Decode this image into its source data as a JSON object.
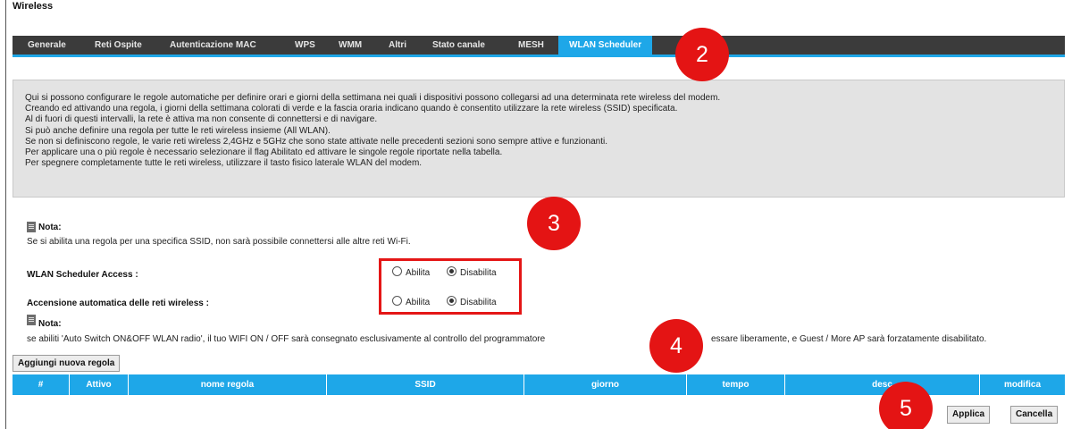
{
  "page": {
    "title": "Wireless"
  },
  "tabs": [
    {
      "label": "Generale",
      "active": false
    },
    {
      "label": "Reti Ospite",
      "active": false
    },
    {
      "label": "Autenticazione MAC",
      "active": false
    },
    {
      "label": "WPS",
      "active": false
    },
    {
      "label": "WMM",
      "active": false
    },
    {
      "label": "Altri",
      "active": false
    },
    {
      "label": "Stato canale",
      "active": false
    },
    {
      "label": "MESH",
      "active": false
    },
    {
      "label": "WLAN Scheduler",
      "active": true
    }
  ],
  "info": {
    "lines": [
      "Qui si possono configurare le regole automatiche per definire orari e giorni della settimana nei quali i dispositivi possono collegarsi ad una determinata rete wireless del modem.",
      "Creando ed attivando una regola, i giorni della settimana colorati di verde e la fascia oraria indicano quando è consentito utilizzare la rete wireless (SSID) specificata.",
      "Al di fuori di questi intervalli, la rete è attiva ma non consente di connettersi e di navigare.",
      "Si può anche definire una regola per tutte le reti wireless insieme (All WLAN).",
      "Se non si definiscono regole, le varie reti wireless 2,4GHz e 5GHz che sono state attivate nelle precedenti sezioni sono sempre attive e funzionanti.",
      "Per applicare una o più regole è necessario selezionare il flag Abilitato ed attivare le singole regole riportate nella tabella.",
      "Per spegnere completamente tutte le reti wireless, utilizzare il tasto fisico laterale WLAN del modem."
    ]
  },
  "note1": {
    "label": "Nota:",
    "text": "Se si abilita una regola per una specifica SSID, non sarà possibile connettersi alle altre reti Wi-Fi."
  },
  "scheduler_access": {
    "label": "WLAN Scheduler Access :",
    "option_enable": "Abilita",
    "option_disable": "Disabilita",
    "selected": "Disabilita"
  },
  "auto_power": {
    "label": "Accensione automatica delle reti wireless :",
    "option_enable": "Abilita",
    "option_disable": "Disabilita",
    "selected": "Disabilita"
  },
  "note2": {
    "label": "Nota:",
    "text_left": "se abiliti 'Auto Switch ON&OFF WLAN radio', il tuo WIFI ON / OFF sarà consegnato esclusivamente al controllo del programmatore",
    "text_right": "essare liberamente, e Guest / More AP sarà forzatamente disabilitato."
  },
  "add_rule_button": "Aggiungi nuova regola",
  "table": {
    "columns": [
      "#",
      "Attivo",
      "nome regola",
      "SSID",
      "giorno",
      "tempo",
      "desc",
      "modifica"
    ]
  },
  "buttons": {
    "apply": "Applica",
    "cancel": "Cancella"
  },
  "badges": [
    "2",
    "3",
    "4",
    "5"
  ],
  "colors": {
    "accent": "#1ea7e8",
    "tabbar": "#3b3b3b",
    "badge": "#e41414",
    "highlight_box": "#e41616"
  }
}
